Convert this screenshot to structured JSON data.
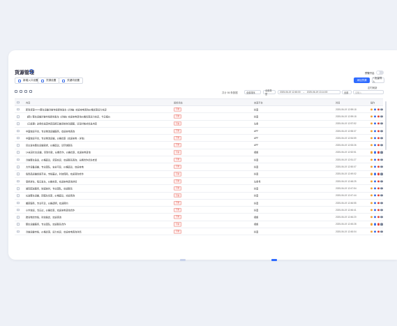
{
  "page": {
    "title": "货源管理"
  },
  "toolbar": {
    "buttons": [
      {
        "label": "新增入口设置"
      },
      {
        "label": "货源设置"
      },
      {
        "label": "关键词设置"
      }
    ],
    "toggle_label": "预警开启",
    "toggle_on": false,
    "primary_label": "添加货源",
    "secondary_label": "+ 批量导入",
    "hint_text": "定时刷新"
  },
  "filters": {
    "count_text": "共计 86 条数据",
    "sort_label": "全部排序",
    "type_value": "全部类型",
    "date_from": "2025-06-19 12:45:00",
    "date_to": "2025-06-19 13:14:00",
    "status_value": "全部",
    "search_placeholder": "请输入"
  },
  "table": {
    "columns": {
      "content": "内容",
      "status": "质检状态",
      "source": "来源平台",
      "time": "时间",
      "ops": "操作"
    },
    "rows": [
      {
        "content": "新到货源××××整车运输冷链专线即刻发车【冷链】欢迎来电咨询价格优惠运力充足",
        "status": "下架",
        "source": "抖音",
        "time": "2025-06-19 12:59:18"
      },
      {
        "content": "【新】整车运输冷链专线即刻发车【冷链】欢迎来电咨询价格优惠运力充足，今日报价",
        "status": "下架",
        "source": "抖音",
        "time": "2025-06-19 12:59:18"
      },
      {
        "content": "（已处理）这条信息因内容违规已被系统自动屏蔽，请及时核对信息内容",
        "status": "下架",
        "source": "头条",
        "time": "2025-06-19 12:57:52"
      },
      {
        "content": "中国快运平台，专业物流运输服务，欢迎来电咨询",
        "status": "下架",
        "source": "APP",
        "time": "2025-06-19 12:55:37"
      },
      {
        "content": "中国快运平台，专业物流运输，价格优惠（欢迎来电→详询）",
        "status": "下架",
        "source": "APP",
        "time": "2025-06-19 12:54:59"
      },
      {
        "content": "货主发布整车运输需求，价格面议，请尽快联系",
        "status": "下架",
        "source": "APP",
        "time": "2025-06-19 12:53:26"
      },
      {
        "content": "14米高栏车运输，货到付款，长期合作，价格优惠，欢迎来电咨询",
        "status": "下架",
        "source": "视频",
        "time": "2025-06-19 12:52:51"
      },
      {
        "content": "冷链整车急发，价格面议，货源充足，欢迎联系咨询，长期合作优先考虑",
        "status": "下架",
        "source": "抖音",
        "time": "2025-06-19 12:51:27"
      },
      {
        "content": "大件设备运输，专业团队，安全可靠，价格面议，欢迎来电",
        "status": "下架",
        "source": "抖音",
        "time": "2025-06-19 12:50:07"
      },
      {
        "content": "危险品运输资质齐全，专线直达，时效保障，欢迎咨询合作",
        "status": "下架",
        "source": "抖音",
        "time": "2025-06-19 12:49:02"
      },
      {
        "content": "零担拼车，每日发车，价格实惠，欢迎来电咨询详情",
        "status": "下架",
        "source": "头条号",
        "time": "2025-06-19 12:48:25"
      },
      {
        "content": "城际配送服务，快速准时，专业团队，欢迎联系",
        "status": "下架",
        "source": "抖音",
        "time": "2025-06-19 12:47:54"
      },
      {
        "content": "长途整车运输，回程车优惠，价格面议，欢迎咨询",
        "status": "下架",
        "source": "抖音",
        "time": "2025-06-19 12:47:44"
      },
      {
        "content": "搬家服务，专业可靠，价格透明，欢迎预约",
        "status": "下架",
        "source": "抖音",
        "time": "2025-06-19 12:46:55"
      },
      {
        "content": "小件快运，当日达，价格优惠，欢迎来电咨询合作",
        "status": "下架",
        "source": "抖音",
        "time": "2025-06-19 12:46:41"
      },
      {
        "content": "跨省物流专线，时效稳定，欢迎咨询",
        "status": "下架",
        "source": "视频",
        "time": "2025-06-19 12:46:20"
      },
      {
        "content": "整车运输服务，专业团队，欢迎联系合作",
        "status": "下架",
        "source": "视频",
        "time": "2025-06-19 12:45:28"
      },
      {
        "content": "冷链运输专线，价格优惠，运力充足，欢迎来电咨询详情",
        "status": "下架",
        "source": "抖音",
        "time": "2025-06-19 12:45:04"
      }
    ]
  },
  "colors": {
    "accent": "#2f6bff",
    "danger": "#e0453a",
    "background": "#eef1f7"
  }
}
